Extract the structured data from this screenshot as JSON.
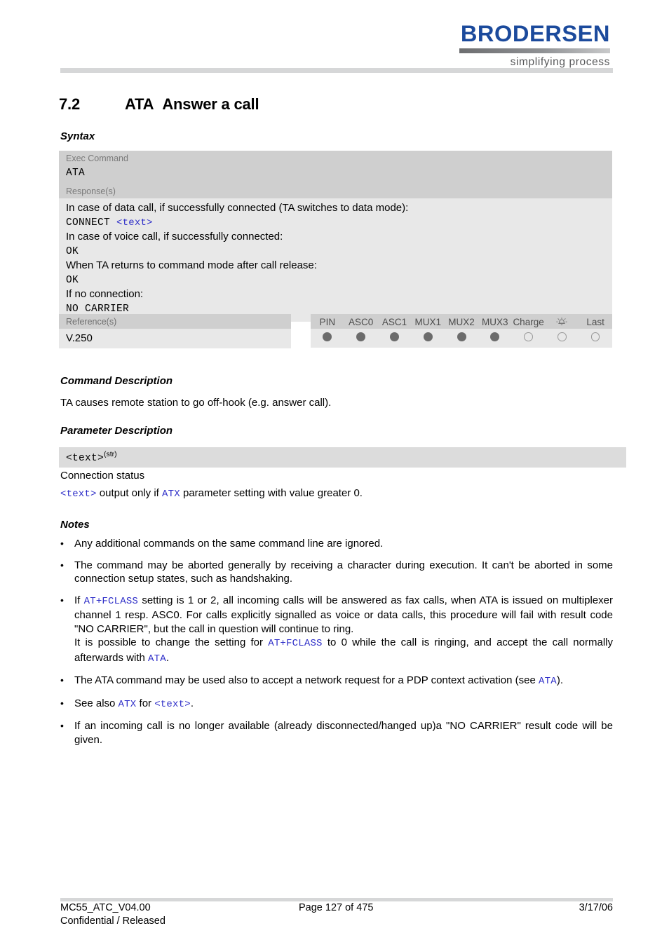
{
  "header": {
    "logo_word": "BRODERSEN",
    "logo_tagline": "simplifying process"
  },
  "section": {
    "number": "7.2",
    "command": "ATA",
    "title": "Answer a call"
  },
  "headings": {
    "syntax": "Syntax",
    "command_description": "Command Description",
    "parameter_description": "Parameter Description",
    "notes": "Notes"
  },
  "syntax": {
    "exec_label": "Exec Command",
    "exec_value": "ATA",
    "response_label": "Response(s)",
    "lines": [
      {
        "type": "plain",
        "text": "In case of data call, if successfully connected (TA switches to data mode):"
      },
      {
        "type": "code_link",
        "code": "CONNECT",
        "link": "<text>"
      },
      {
        "type": "plain",
        "text": "In case of voice call, if successfully connected:"
      },
      {
        "type": "code",
        "text": "OK"
      },
      {
        "type": "plain",
        "text": "When TA returns to command mode after call release:"
      },
      {
        "type": "code",
        "text": "OK"
      },
      {
        "type": "plain",
        "text": "If no connection:"
      },
      {
        "type": "code",
        "text": "NO CARRIER"
      }
    ]
  },
  "reference": {
    "label": "Reference(s)",
    "value": "V.250"
  },
  "capabilities": {
    "columns": [
      "PIN",
      "ASC0",
      "ASC1",
      "MUX1",
      "MUX2",
      "MUX3",
      "Charge",
      "alarm-icon",
      "Last"
    ],
    "states": [
      true,
      true,
      true,
      true,
      true,
      true,
      false,
      false,
      false
    ],
    "icon_column_index": 7,
    "icon_name": "alarm-bell-icon"
  },
  "command_description": {
    "text": "TA causes remote station to go off-hook (e.g. answer call)."
  },
  "parameter": {
    "name": "<text>",
    "type_sup": "(str)",
    "description": "Connection status",
    "note_prefix": "<text>",
    "note_mid": " output only if ",
    "note_link": "ATX",
    "note_suffix": " parameter setting with value greater 0."
  },
  "notes": [
    {
      "id": "note-1",
      "justify": false,
      "segments": [
        {
          "t": "Any additional commands on the same command line are ignored.",
          "k": "plain"
        }
      ]
    },
    {
      "id": "note-2",
      "justify": true,
      "segments": [
        {
          "t": "The command may be aborted generally by receiving a character during execution. It can't be aborted in some connection setup states, such as handshaking.",
          "k": "plain"
        }
      ]
    },
    {
      "id": "note-3",
      "justify": true,
      "segments": [
        {
          "t": "If ",
          "k": "plain"
        },
        {
          "t": "AT+FCLASS",
          "k": "link"
        },
        {
          "t": " setting is 1 or 2, all incoming calls will be answered as fax calls, when ATA is issued on multiplexer channel 1 resp. ASC0. For calls explicitly signalled as voice or data calls, this procedure will fail with result code \"NO CARRIER\", but the call in question will continue to ring.",
          "k": "plain"
        },
        {
          "t": "\n",
          "k": "break"
        },
        {
          "t": "It is possible to change the setting for ",
          "k": "plain"
        },
        {
          "t": "AT+FCLASS",
          "k": "link"
        },
        {
          "t": " to 0 while the call is ringing, and accept the call normally afterwards with ",
          "k": "plain"
        },
        {
          "t": "ATA",
          "k": "link"
        },
        {
          "t": ".",
          "k": "plain"
        }
      ]
    },
    {
      "id": "note-4",
      "justify": false,
      "segments": [
        {
          "t": "The ATA command may be used also to accept a network request for a PDP context activation (see ",
          "k": "plain"
        },
        {
          "t": "ATA",
          "k": "link"
        },
        {
          "t": ").",
          "k": "plain"
        }
      ]
    },
    {
      "id": "note-5",
      "justify": false,
      "segments": [
        {
          "t": "See also ",
          "k": "plain"
        },
        {
          "t": "ATX",
          "k": "link"
        },
        {
          "t": " for ",
          "k": "plain"
        },
        {
          "t": "<text>",
          "k": "link"
        },
        {
          "t": ".",
          "k": "plain"
        }
      ]
    },
    {
      "id": "note-6",
      "justify": true,
      "segments": [
        {
          "t": "If an incoming call is no longer available (already disconnected/hanged up)a \"NO CARRIER\" result code will be given.",
          "k": "plain"
        }
      ]
    }
  ],
  "footer": {
    "doc_id": "MC55_ATC_V04.00",
    "classification": "Confidential / Released",
    "page": "Page 127 of 475",
    "date": "3/17/06"
  },
  "bullet_char": "•",
  "colors": {
    "logo_blue": "#1b4a9c",
    "link_blue": "#2e2ec8",
    "row_label_gray": "#cfcfcf",
    "row_body_gray": "#e8e8e8",
    "param_bar_gray": "#dcdcdc",
    "rule_gray": "#d6d7d8",
    "dot_on": "#6b6b6b",
    "dot_off_border": "#9a9a9a"
  }
}
